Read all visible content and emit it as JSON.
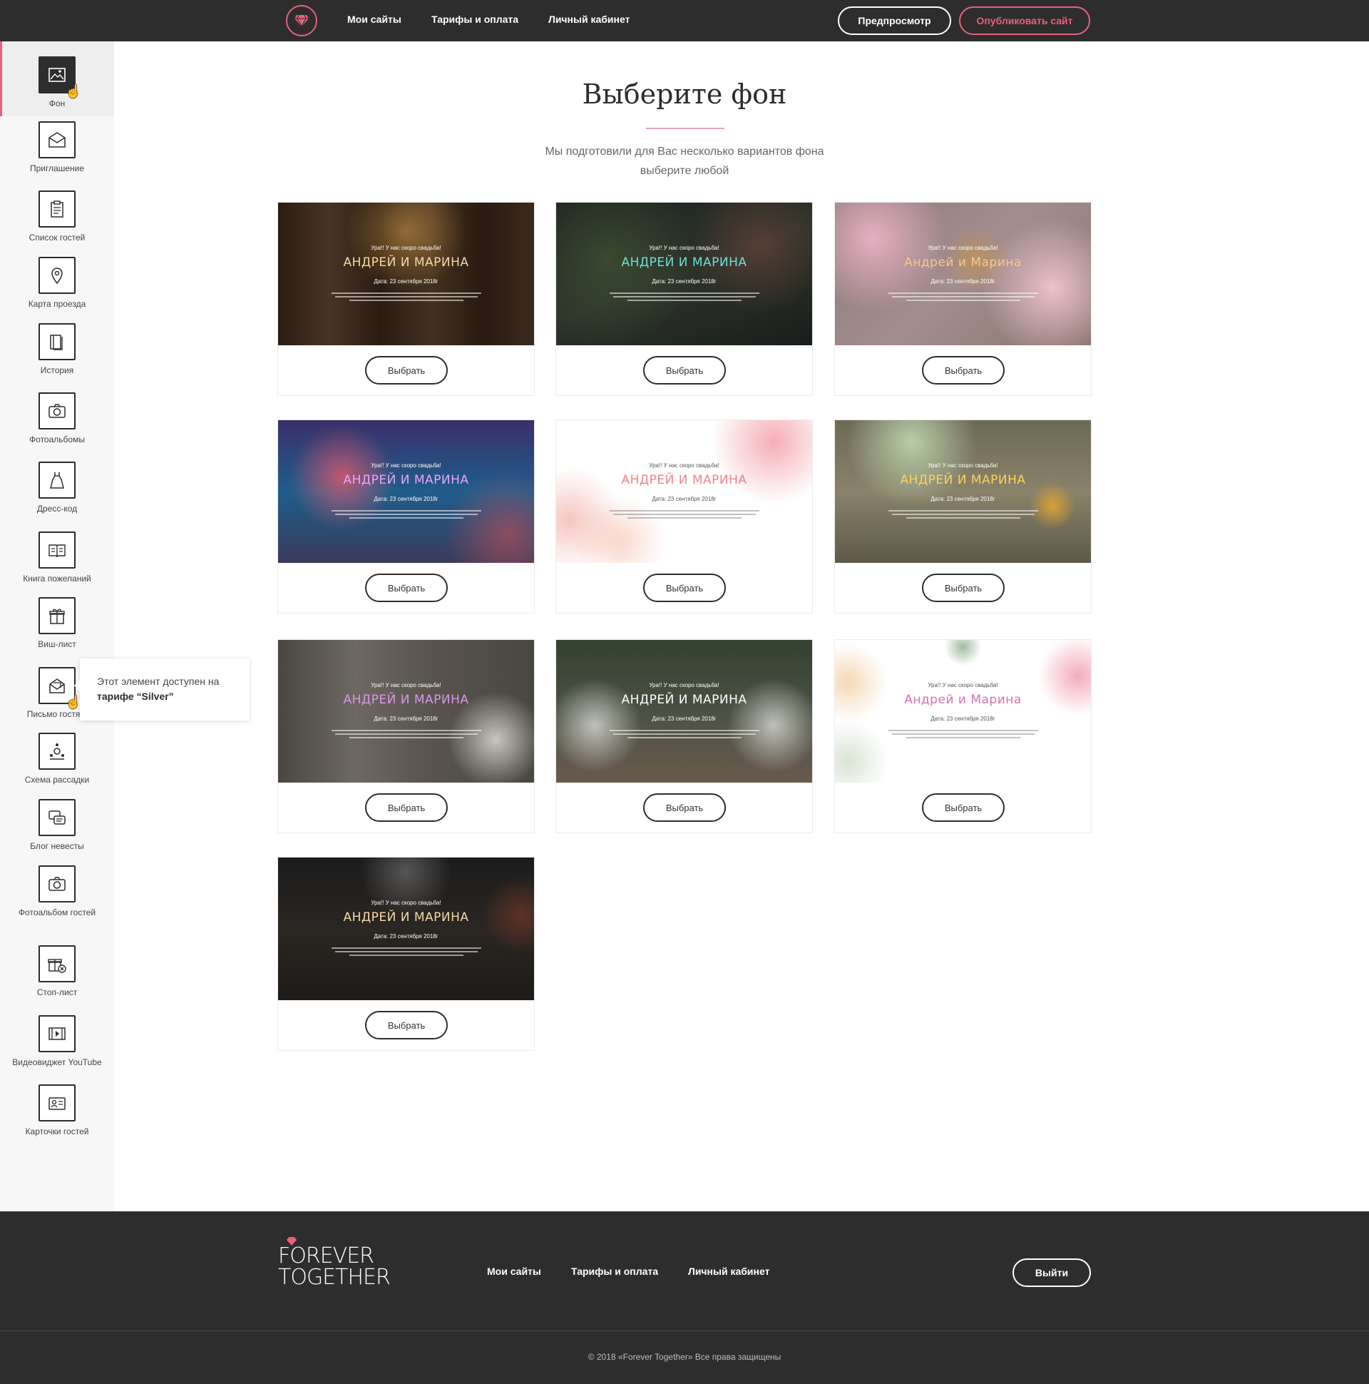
{
  "header": {
    "nav": [
      "Мои сайты",
      "Тарифы и оплата",
      "Личный кабинет"
    ],
    "preview_label": "Предпросмотр",
    "publish_label": "Опубликовать сайт",
    "accent": "#e8607c"
  },
  "sidebar": {
    "items": [
      {
        "label": "Фон",
        "icon": "image-icon"
      },
      {
        "label": "Приглашение",
        "icon": "envelope-icon"
      },
      {
        "label": "Список гостей",
        "icon": "clipboard-icon"
      },
      {
        "label": "Карта проезда",
        "icon": "map-pin-icon"
      },
      {
        "label": "История",
        "icon": "book-icon"
      },
      {
        "label": "Фотоальбомы",
        "icon": "camera-icon"
      },
      {
        "label": "Дресс-код",
        "icon": "dress-icon"
      },
      {
        "label": "Книга пожеланий",
        "icon": "open-book-icon"
      },
      {
        "label": "Виш-лист",
        "icon": "gift-icon"
      },
      {
        "label": "Письмо гостя...",
        "icon": "letter-icon"
      },
      {
        "label": "Схема рассадки",
        "icon": "seating-icon"
      },
      {
        "label": "Блог невесты",
        "icon": "chat-icon"
      },
      {
        "label": "Фотоальбом гостей",
        "icon": "camera-icon"
      },
      {
        "label": "Стоп-лист",
        "icon": "gift-cancel-icon"
      },
      {
        "label": "Видеовиджет YouTube",
        "icon": "video-icon"
      },
      {
        "label": "Карточки гостей",
        "icon": "card-icon"
      }
    ]
  },
  "tooltip": {
    "text": "Этот элемент доступен на",
    "plan": "тарифе “Silver”"
  },
  "main": {
    "title": "Выберите фон",
    "subtitle_line1": "Мы подготовили для Вас несколько вариантов фона",
    "subtitle_line2": "выберите любой",
    "choose_label": "Выбрать",
    "preview_text": {
      "greeting": "Ура!! У нас скоро свадьба!",
      "names": "АНДРЕЙ И МАРИНА",
      "names_alt": "Андрей и Марина",
      "date": "Дата: 23 сентября 2018г"
    },
    "backgrounds": [
      {
        "theme": "wood",
        "name_color": "#f3d7a5"
      },
      {
        "theme": "greenery",
        "name_color": "#6fe0d6"
      },
      {
        "theme": "peonies",
        "name_color": "#f6c78c"
      },
      {
        "theme": "tropical",
        "name_color": "#e6a7f2"
      },
      {
        "theme": "watercolor",
        "name_color": "#f0848a"
      },
      {
        "theme": "table",
        "name_color": "#ffd25a"
      },
      {
        "theme": "vintage",
        "name_color": "#d996e8"
      },
      {
        "theme": "garden",
        "name_color": "#ffffff"
      },
      {
        "theme": "floral-white",
        "name_color": "#d86fb4"
      },
      {
        "theme": "restaurant",
        "name_color": "#f6d9a8"
      }
    ]
  },
  "footer": {
    "logo_line1": "FOREVER",
    "logo_line2": "TOGETHER",
    "nav": [
      "Мои сайты",
      "Тарифы и оплата",
      "Личный кабинет"
    ],
    "logout_label": "Выйти",
    "copyright": "© 2018 «Forever Together» Все права защищены"
  }
}
